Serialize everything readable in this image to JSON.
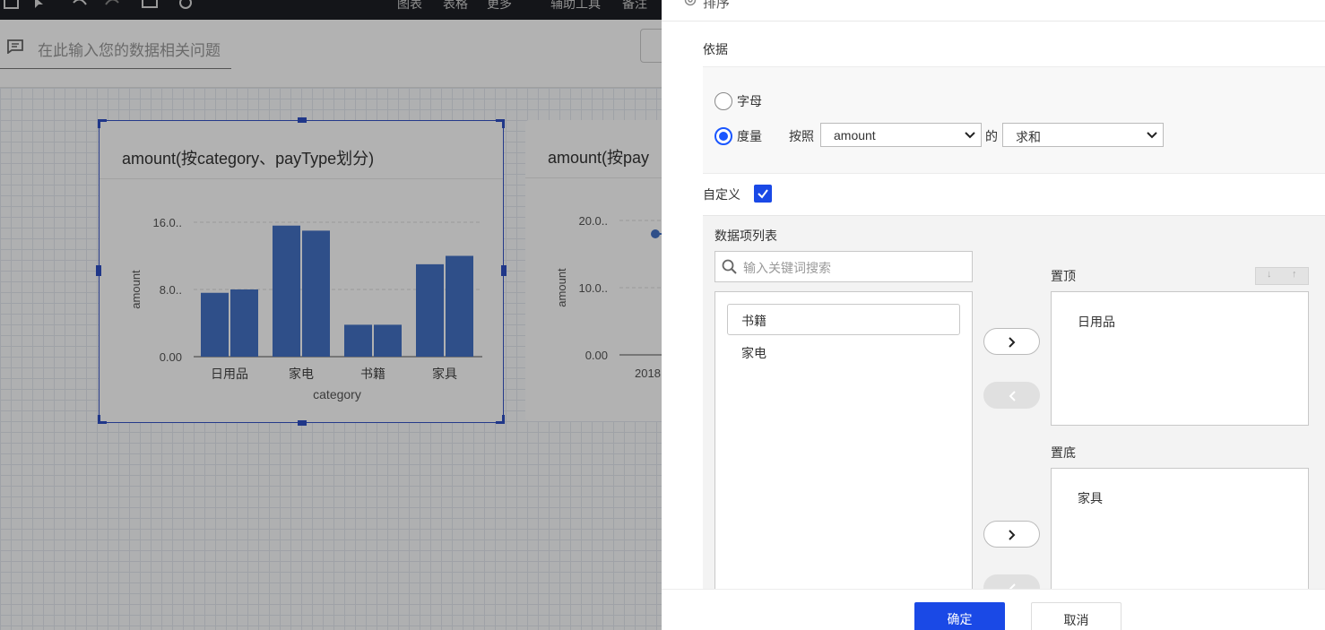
{
  "app": {
    "toolbar_menu": [
      "图表",
      "表格",
      "更多",
      "辅助工具",
      "备注"
    ],
    "question_placeholder": "在此输入您的数据相关问题"
  },
  "cards": [
    {
      "title": "amount(按category、payType划分)",
      "chart_data": {
        "type": "bar",
        "categories": [
          "日用品",
          "家电",
          "书籍",
          "家具"
        ],
        "series": [
          {
            "values": [
              7.6,
              15.6,
              3.8,
              11.0
            ]
          },
          {
            "values": [
              8.0,
              15.0,
              3.8,
              12.0
            ]
          }
        ],
        "ylabel": "amount",
        "xlabel": "category",
        "ytick_labels": [
          "0.00",
          "8.0..",
          "16.0.."
        ],
        "ylim": [
          0,
          16.0
        ],
        "color": "#4472c4",
        "grid": true
      }
    },
    {
      "title": "amount(按pay",
      "chart_data": {
        "type": "line",
        "x": [
          "2018"
        ],
        "series": [
          {
            "values": [
              18.0
            ]
          }
        ],
        "ylabel": "amount",
        "ytick_labels": [
          "0.00",
          "10.0..",
          "20.0.."
        ],
        "ylim": [
          0,
          20.0
        ],
        "color": "#4472c4"
      }
    }
  ],
  "panel": {
    "title": "排序",
    "basis_label": "依据",
    "radio_letter": "字母",
    "radio_measure": "度量",
    "by_label": "按照",
    "measure_select": "amount",
    "of_label": "的",
    "agg_select": "求和",
    "custom_label": "自定义",
    "list_title": "数据项列表",
    "search_placeholder": "输入关键词搜索",
    "items": [
      "书籍",
      "家电"
    ],
    "top_label": "置顶",
    "top_items": [
      "日用品"
    ],
    "bottom_label": "置底",
    "bottom_items": [
      "家具"
    ],
    "mini_down": "↓",
    "mini_up": "↑",
    "ok": "确定",
    "cancel": "取消",
    "accent_color": "#1a49e6"
  }
}
